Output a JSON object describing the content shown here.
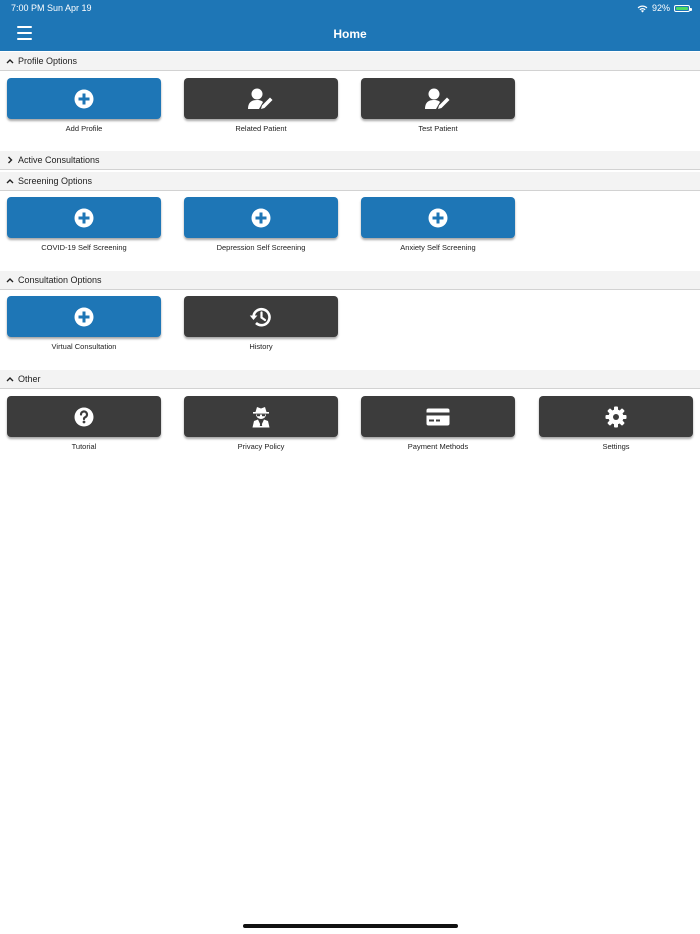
{
  "status": {
    "time": "7:00 PM   Sun Apr 19",
    "battery": "92%"
  },
  "header": {
    "title": "Home"
  },
  "sections": {
    "profile": "Profile Options",
    "active": "Active Consultations",
    "screening": "Screening Options",
    "consultation": "Consultation Options",
    "other": "Other"
  },
  "tiles": {
    "add_profile": "Add Profile",
    "related_patient": "Related Patient",
    "test_patient": "Test Patient",
    "covid": "COVID-19 Self Screening",
    "depression": "Depression Self Screening",
    "anxiety": "Anxiety Self Screening",
    "virtual": "Virtual Consultation",
    "history": "History",
    "tutorial": "Tutorial",
    "privacy": "Privacy Policy",
    "payment": "Payment Methods",
    "settings": "Settings"
  },
  "colors": {
    "brand": "#1e76b6",
    "dark_tile": "#3c3c3c",
    "section_bg": "#f3f3f3"
  }
}
